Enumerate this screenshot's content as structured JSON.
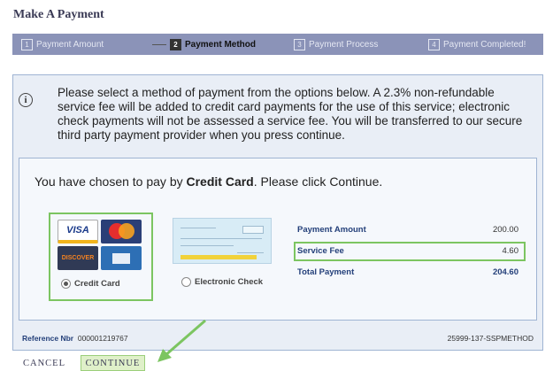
{
  "page": {
    "title": "Make A Payment"
  },
  "steps": [
    {
      "num": "1",
      "label": "Payment Amount"
    },
    {
      "num": "2",
      "label": "Payment Method"
    },
    {
      "num": "3",
      "label": "Payment Process"
    },
    {
      "num": "4",
      "label": "Payment Completed!"
    }
  ],
  "info": {
    "icon": "info-icon",
    "text": "Please select a method of payment from the options below. A 2.3% non-refundable service fee will be added to credit card payments for the use of this service; electronic check payments will not be assessed a service fee. You will be transferred to our secure third party payment provider when you press continue."
  },
  "chosen": {
    "prefix": "You have chosen to pay by ",
    "method": "Credit Card",
    "suffix": ". Please click Continue."
  },
  "options": {
    "credit_card": {
      "label": "Credit Card",
      "selected": true,
      "card_text": {
        "visa": "VISA",
        "discover": "DISCOVER"
      }
    },
    "echeck": {
      "label": "Electronic Check",
      "selected": false
    }
  },
  "summary": {
    "amount_label": "Payment Amount",
    "amount_value": "200.00",
    "fee_label": "Service Fee",
    "fee_value": "4.60",
    "total_label": "Total Payment",
    "total_value": "204.60"
  },
  "footer": {
    "ref_label": "Reference Nbr",
    "ref_value": "000001219767",
    "code": "25999-137-SSPMETHOD"
  },
  "buttons": {
    "cancel": "Cancel",
    "continue": "Continue"
  },
  "colors": {
    "step_bar": "#8b93b8",
    "panel_bg": "#e9eef6",
    "highlight": "#7cc561",
    "arrow": "#7cc561"
  }
}
